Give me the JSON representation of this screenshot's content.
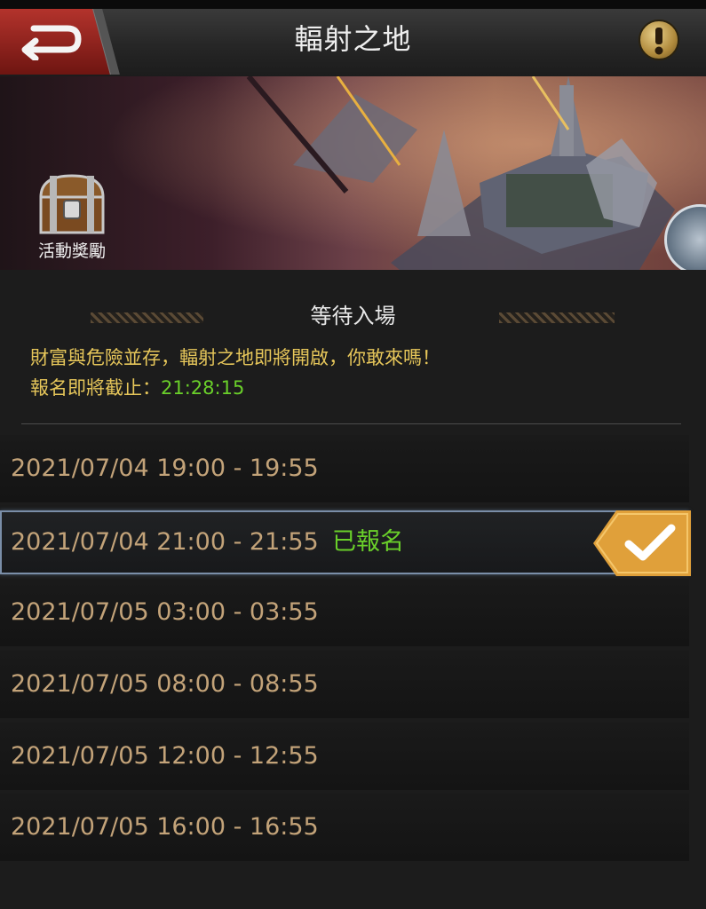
{
  "header": {
    "title": "輻射之地"
  },
  "banner": {
    "reward_label": "活動獎勵"
  },
  "event": {
    "status": "等待入場",
    "description": "財富與危險並存，輻射之地即將開啟，你敢來嗎！",
    "deadline_label": "報名即將截止：",
    "countdown": "21:28:15"
  },
  "slots": [
    {
      "time": "2021/07/04 19:00 - 19:55",
      "status": "",
      "selected": false
    },
    {
      "time": "2021/07/04 21:00 - 21:55",
      "status": "已報名",
      "selected": true
    },
    {
      "time": "2021/07/05 03:00 - 03:55",
      "status": "",
      "selected": false
    },
    {
      "time": "2021/07/05 08:00 - 08:55",
      "status": "",
      "selected": false
    },
    {
      "time": "2021/07/05 12:00 - 12:55",
      "status": "",
      "selected": false
    },
    {
      "time": "2021/07/05 16:00 - 16:55",
      "status": "",
      "selected": false
    }
  ],
  "colors": {
    "slot_time": "#c3a379",
    "accent_green": "#6ad02a",
    "promo_gold": "#e6c65a",
    "check_badge": "#e0a03a",
    "back_button": "#a02a24"
  },
  "icons": {
    "back": "back-arrow-icon",
    "info": "exclamation-icon",
    "reward": "treasure-chest-icon",
    "check": "checkmark-icon"
  }
}
